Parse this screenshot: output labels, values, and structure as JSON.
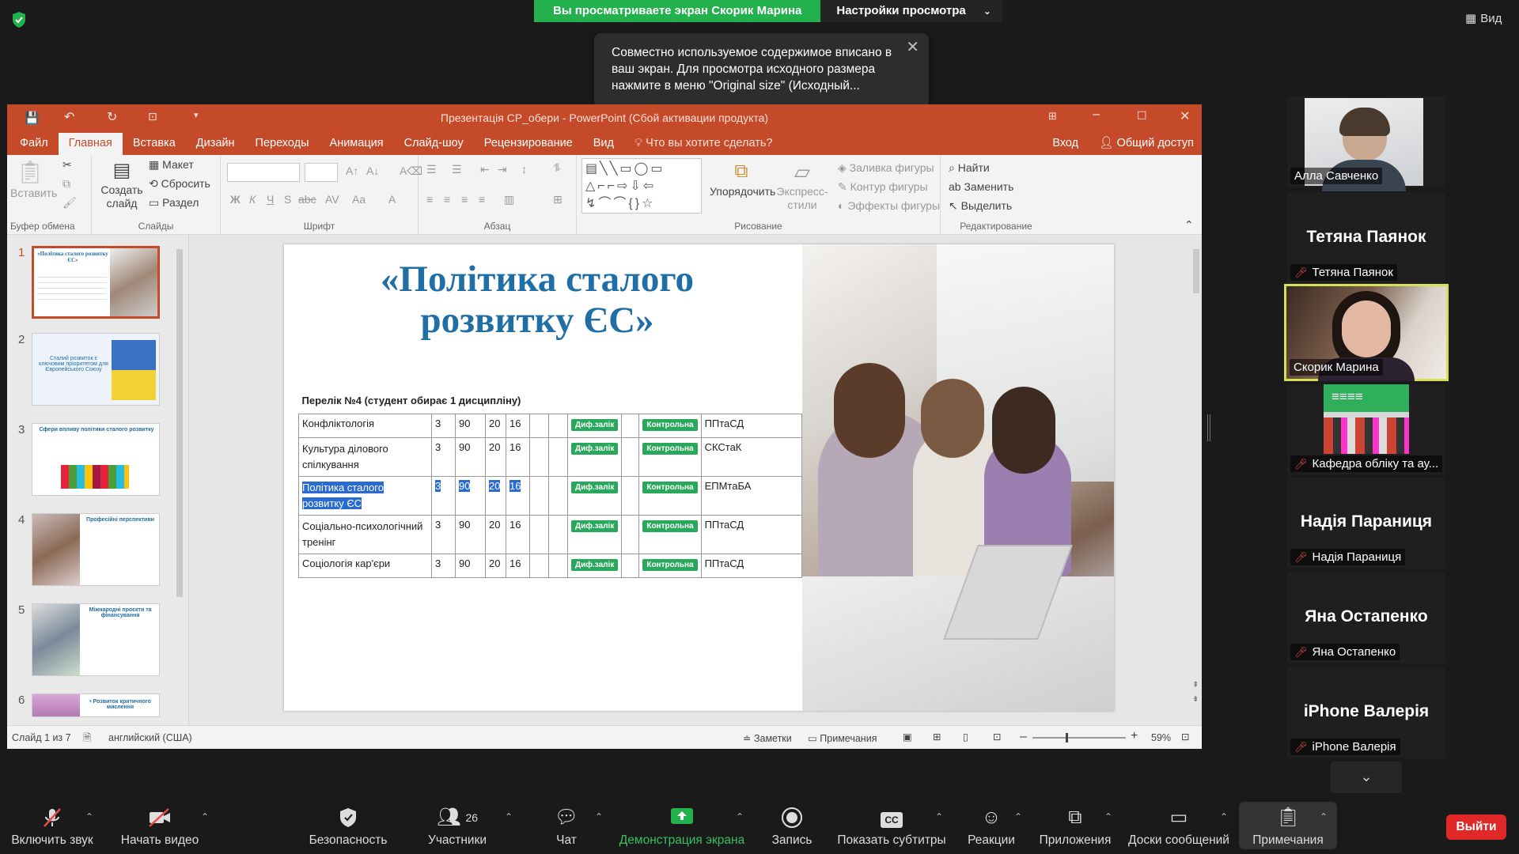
{
  "zoom_header": {
    "sharing_banner": "Вы просматриваете экран Скорик Марина",
    "view_options": "Настройки просмотра",
    "view_button": "Вид"
  },
  "tooltip": {
    "text": "Совместно используемое содержимое вписано в ваш экран. Для просмотра исходного размера нажмите в меню \"Original size\" (Исходный..."
  },
  "ppt": {
    "window_title": "Презентація СР_обери - PowerPoint (Сбой активации продукта)",
    "tabs": [
      "Файл",
      "Главная",
      "Вставка",
      "Дизайн",
      "Переходы",
      "Анимация",
      "Слайд-шоу",
      "Рецензирование",
      "Вид"
    ],
    "tell_me": "Что вы хотите сделать?",
    "signin": "Вход",
    "share": "Общий доступ",
    "ribbon": {
      "paste": "Вставить",
      "clipboard": "Буфер обмена",
      "new_slide_1": "Создать",
      "new_slide_2": "слайд",
      "layout": "Макет",
      "reset": "Сбросить",
      "section": "Раздел",
      "slides": "Слайды",
      "font": "Шрифт",
      "paragraph": "Абзац",
      "arrange": "Упорядочить",
      "quick_styles_1": "Экспресс-",
      "quick_styles_2": "стили",
      "shape_fill": "Заливка фигуры",
      "shape_outline": "Контур фигуры",
      "shape_effects": "Эффекты фигуры",
      "drawing": "Рисование",
      "find": "Найти",
      "replace": "Заменить",
      "select": "Выделить",
      "editing": "Редактирование"
    },
    "thumbnails": [
      {
        "num": "1",
        "text": "«Політика сталого розвитку ЄС»"
      },
      {
        "num": "2",
        "text": "Сталий розвиток є ключовим пріоритетом для Європейського Союзу"
      },
      {
        "num": "3",
        "text": "Сфери впливу політики сталого розвитку"
      },
      {
        "num": "4",
        "text": "Професійні перспективи"
      },
      {
        "num": "5",
        "text": "Міжнародні проєкти та фінансування"
      },
      {
        "num": "6",
        "text": "• Розвиток критичного мислення"
      }
    ],
    "slide": {
      "title_line1": "«Політика сталого",
      "title_line2": "розвитку ЄС»",
      "table_header": "Перелік №4 (студент обирає 1 дисципліну)",
      "rows": [
        {
          "name": "Конфліктологія",
          "c1": "3",
          "c2": "90",
          "c3": "20",
          "c4": "16",
          "badge1": "Диф.залік",
          "badge2": "Контрольна",
          "dept": "ППтаСД"
        },
        {
          "name": "Культура ділового спілкування",
          "c1": "3",
          "c2": "90",
          "c3": "20",
          "c4": "16",
          "badge1": "Диф.залік",
          "badge2": "Контрольна",
          "dept": "СКСтаК"
        },
        {
          "name": "Політика сталого розвитку ЄС",
          "c1": "3",
          "c2": "90",
          "c3": "20",
          "c4": "16",
          "badge1": "Диф.залік",
          "badge2": "Контрольна",
          "dept": "ЕПМтаБА"
        },
        {
          "name": "Соціально-психологічний тренінг",
          "c1": "3",
          "c2": "90",
          "c3": "20",
          "c4": "16",
          "badge1": "Диф.залік",
          "badge2": "Контрольна",
          "dept": "ППтаСД"
        },
        {
          "name": "Соціологія кар'єри",
          "c1": "3",
          "c2": "90",
          "c3": "20",
          "c4": "16",
          "badge1": "Диф.залік",
          "badge2": "Контрольна",
          "dept": "ППтаСД"
        }
      ]
    },
    "status": {
      "slide_count": "Слайд 1 из 7",
      "language": "английский (США)",
      "notes": "Заметки",
      "comments": "Примечания",
      "zoom": "59%"
    }
  },
  "participants": [
    {
      "name": "Алла Савченко",
      "video": true
    },
    {
      "name": "Тетяна Паянок",
      "video": false,
      "muted": true
    },
    {
      "name": "Скорик Марина",
      "video": true,
      "active": true
    },
    {
      "name": "Кафедра обліку та ау...",
      "video": true,
      "muted": true
    },
    {
      "name": "Надія Параниця",
      "video": false,
      "muted": true
    },
    {
      "name": "Яна Остапенко",
      "video": false,
      "muted": true
    },
    {
      "name": "iPhone Валерія",
      "video": false,
      "muted": true
    }
  ],
  "toolbar": {
    "unmute": "Включить звук",
    "start_video": "Начать видео",
    "security": "Безопасность",
    "participants": "Участники",
    "participants_count": "26",
    "chat": "Чат",
    "share_screen": "Демонстрация экрана",
    "record": "Запись",
    "captions": "Показать субтитры",
    "reactions": "Реакции",
    "apps": "Приложения",
    "whiteboards": "Доски сообщений",
    "notes": "Примечания",
    "leave": "Выйти"
  },
  "colors": {
    "accent_green": "#23b14d",
    "ppt_red": "#c54a2a",
    "leave_red": "#e02828",
    "active_speaker": "#d4e157"
  }
}
